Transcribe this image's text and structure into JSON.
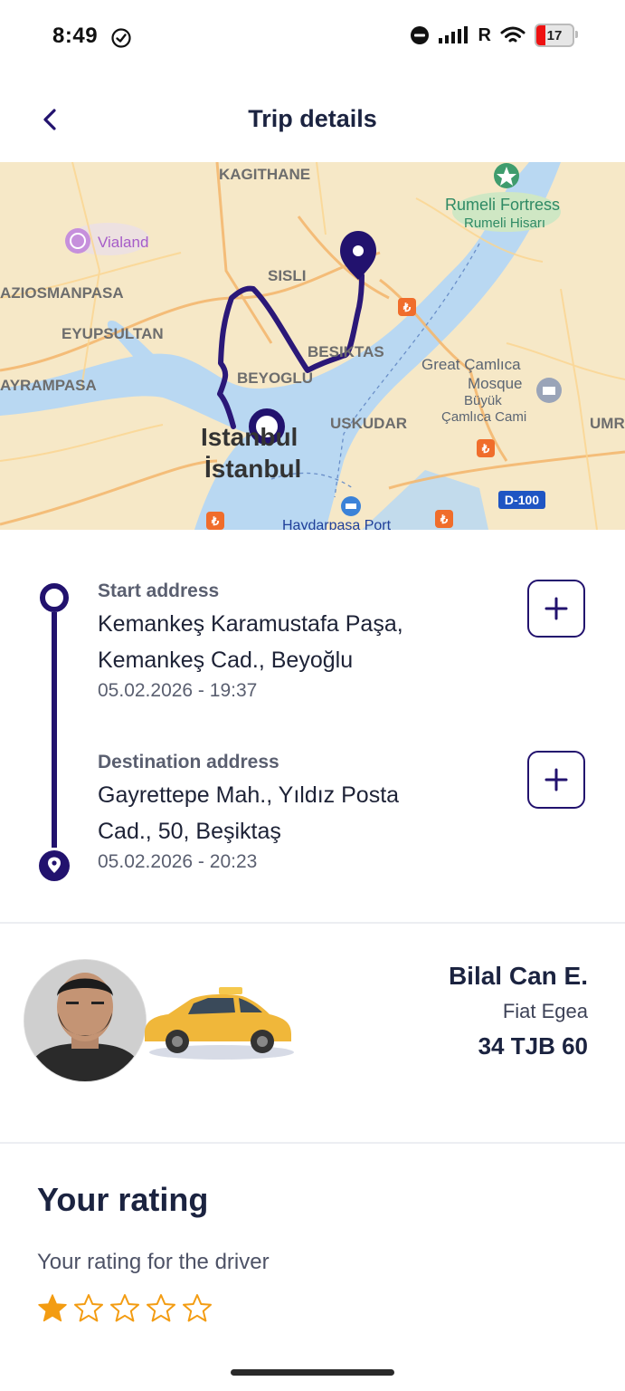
{
  "status_bar": {
    "time": "8:49",
    "carrier": "R",
    "battery_level": "17"
  },
  "header": {
    "title": "Trip details"
  },
  "map": {
    "labels": {
      "kagithane": "KAGITHANE",
      "rumeli_fortress": "Rumeli Fortress",
      "rumeli_hisari": "Rumeli Hisarı",
      "vialand": "Vialand",
      "sisli": "SISLI",
      "gaziosmanpasa": "AZIOSMANPASA",
      "eyupsultan": "EYUPSULTAN",
      "besiktas": "BESIKTAS",
      "beyoglu": "BEYOGLU",
      "great_camlica": "Great Çamlıca",
      "mosque": "Mosque",
      "buyuk": "Büyük",
      "camlica_cami": "Çamlıca Cami",
      "bayrampasa": "AYRAMPASA",
      "istanbul_en": "Istanbul",
      "istanbul_tr": "İstanbul",
      "uskudar": "USKUDAR",
      "umr": "UMR",
      "d100": "D-100",
      "haydarpasa": "Haydarpasa Port"
    }
  },
  "trip": {
    "start": {
      "label": "Start address",
      "line1": "Kemankeş Karamustafa Paşa,",
      "line2": "Kemankeş Cad., Beyoğlu",
      "time": "05.02.2026 - 19:37"
    },
    "destination": {
      "label": "Destination address",
      "line1": "Gayrettepe Mah., Yıldız Posta",
      "line2": "Cad., 50, Beşiktaş",
      "time": "05.02.2026 - 20:23"
    }
  },
  "driver": {
    "name": "Bilal Can E.",
    "car": "Fiat Egea",
    "plate": "34 TJB 60"
  },
  "rating": {
    "title": "Your rating",
    "subtitle": "Your rating for the driver",
    "value": 1,
    "max": 5
  },
  "colors": {
    "primary": "#22126e",
    "star": "#f39c12",
    "water": "#b9d8f2",
    "land": "#f6e8c7"
  }
}
